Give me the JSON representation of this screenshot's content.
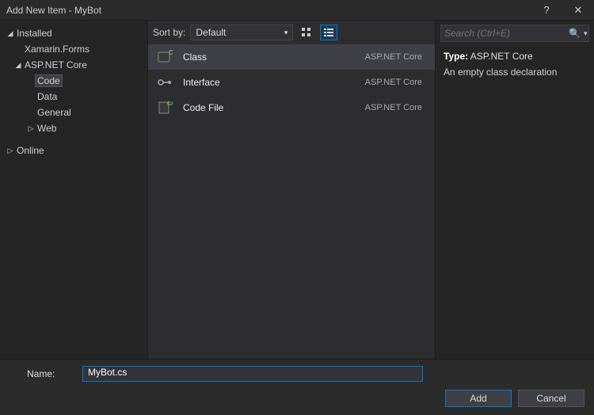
{
  "window": {
    "title": "Add New Item - MyBot",
    "help": "?",
    "close": "✕"
  },
  "tree": {
    "installed": "Installed",
    "xamarin": "Xamarin.Forms",
    "aspnet": "ASP.NET Core",
    "code": "Code",
    "data": "Data",
    "general": "General",
    "web": "Web",
    "online": "Online"
  },
  "sort": {
    "label": "Sort by:",
    "value": "Default"
  },
  "items": [
    {
      "name": "Class",
      "category": "ASP.NET Core"
    },
    {
      "name": "Interface",
      "category": "ASP.NET Core"
    },
    {
      "name": "Code File",
      "category": "ASP.NET Core"
    }
  ],
  "search": {
    "placeholder": "Search (Ctrl+E)"
  },
  "details": {
    "typeLabel": "Type:",
    "typeValue": "ASP.NET Core",
    "description": "An empty class declaration"
  },
  "name": {
    "label": "Name:",
    "value": "MyBot.cs"
  },
  "buttons": {
    "add": "Add",
    "cancel": "Cancel"
  }
}
